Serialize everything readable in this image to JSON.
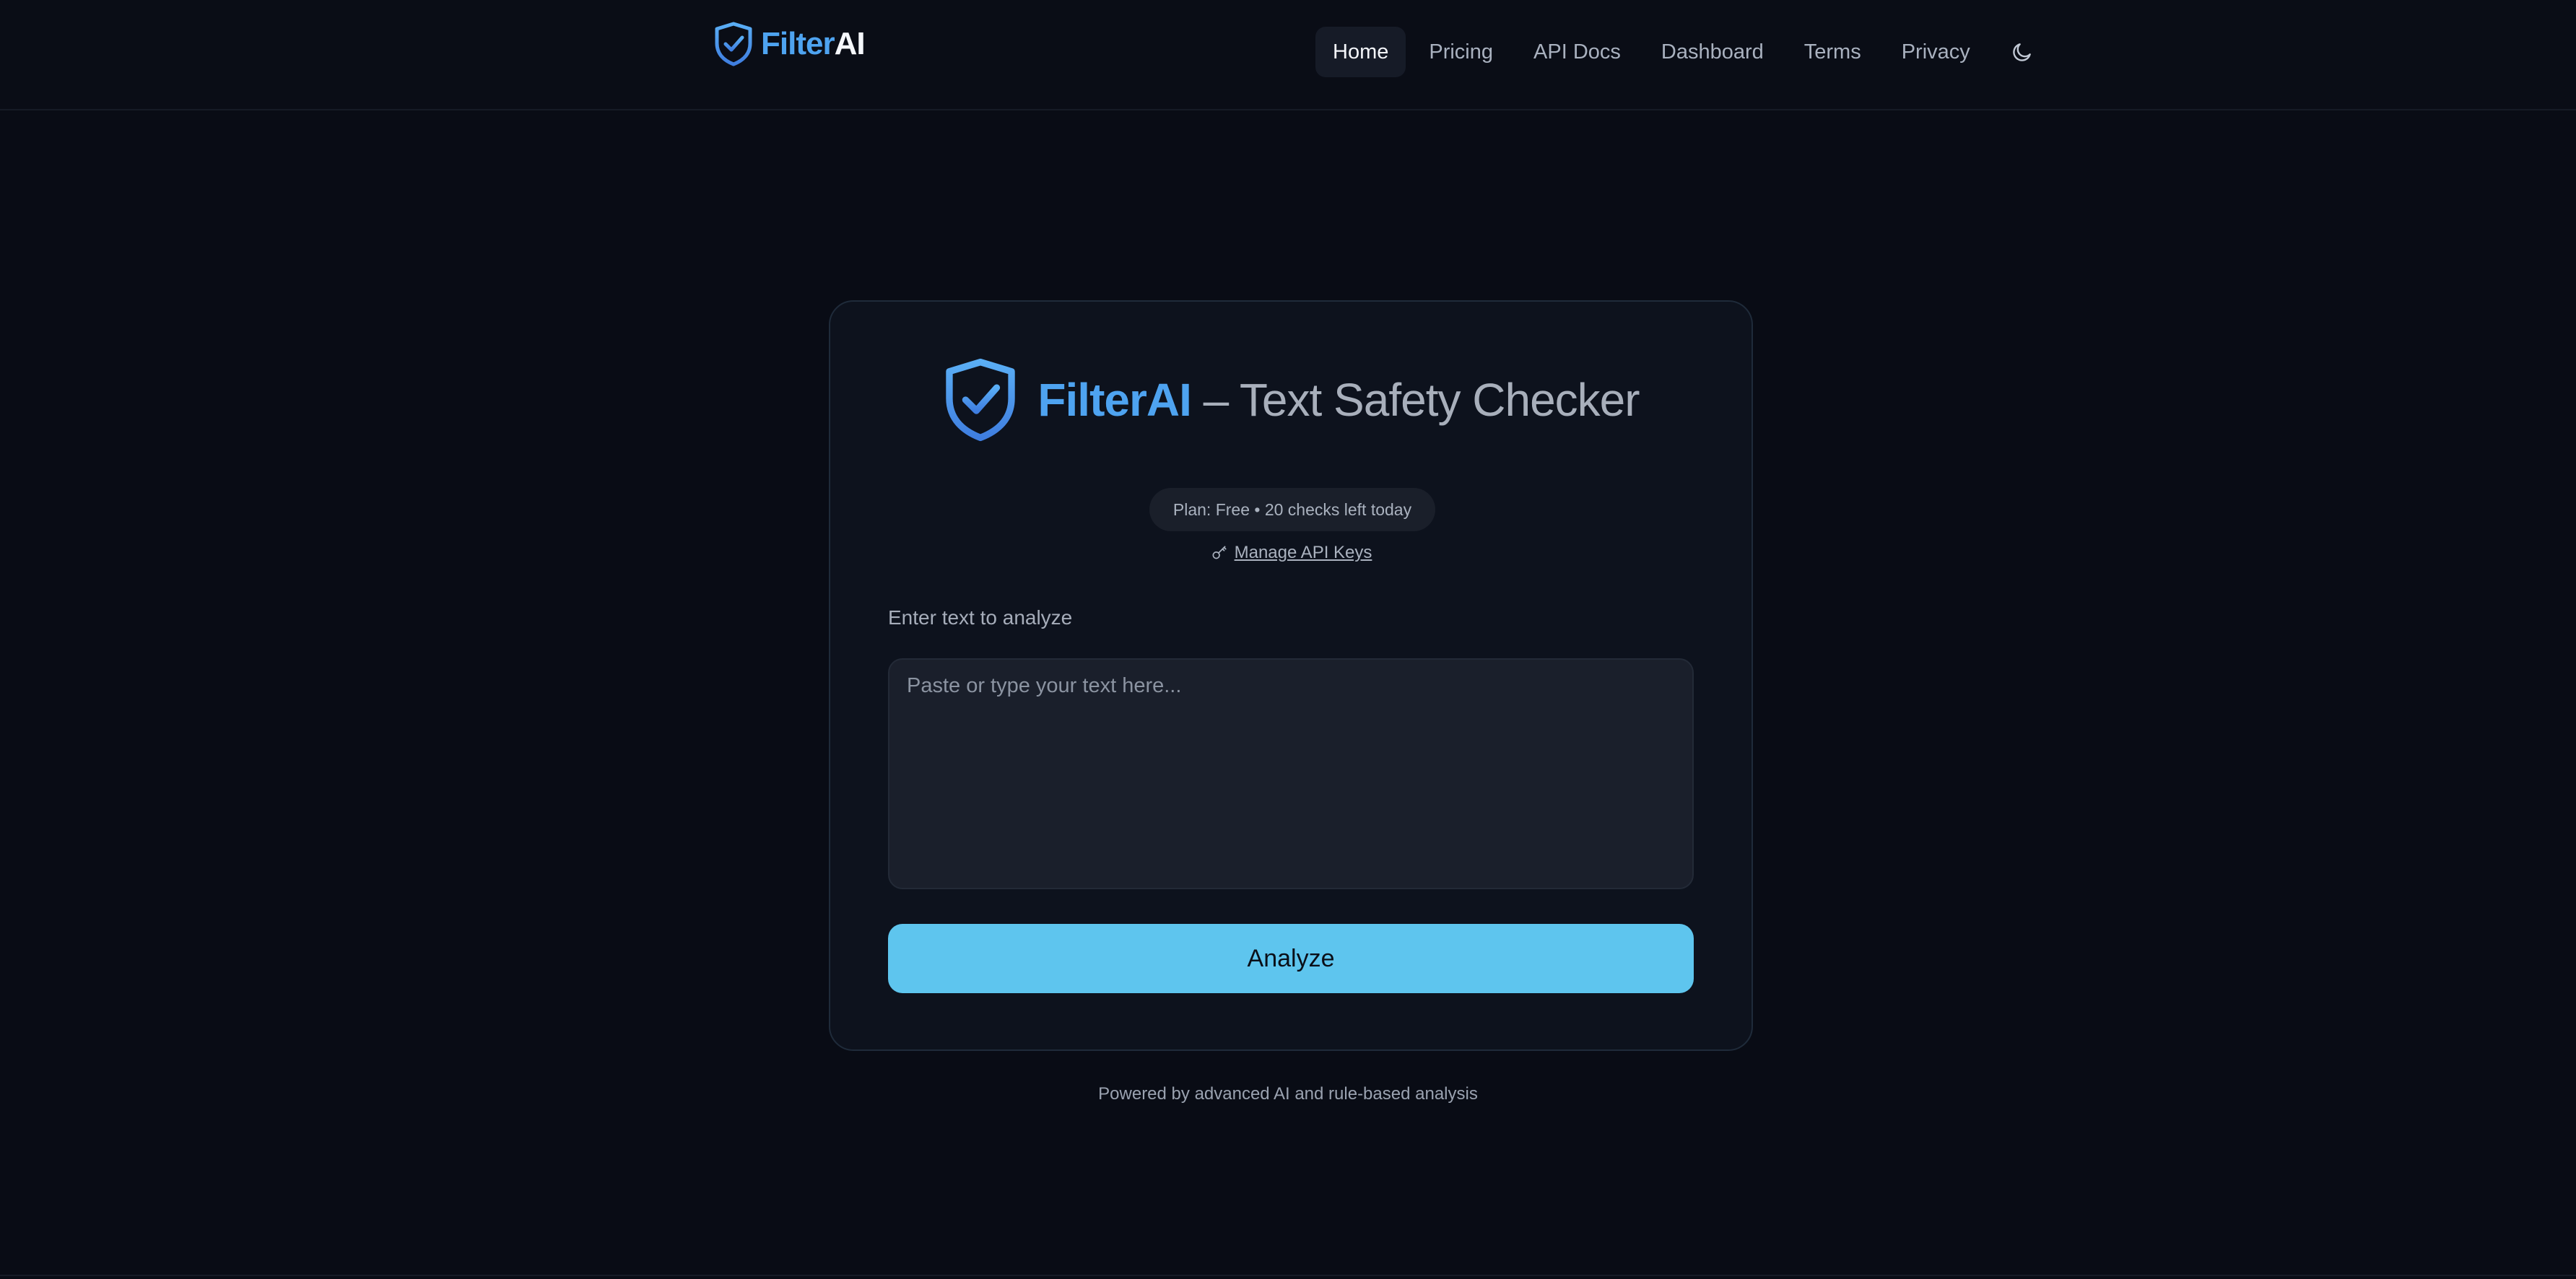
{
  "header": {
    "brand": {
      "part1": "Filter",
      "part2": "AI",
      "icon": "shield-check-icon"
    },
    "nav": [
      {
        "label": "Home",
        "active": true
      },
      {
        "label": "Pricing",
        "active": false
      },
      {
        "label": "API Docs",
        "active": false
      },
      {
        "label": "Dashboard",
        "active": false
      },
      {
        "label": "Terms",
        "active": false
      },
      {
        "label": "Privacy",
        "active": false
      }
    ],
    "theme_toggle_icon": "moon-icon"
  },
  "card": {
    "title_brand": "FilterAI",
    "title_rest": " – Text Safety Checker",
    "plan_badge": "Plan: Free • 20 checks left today",
    "api_keys_icon": "key-icon",
    "api_keys_link": "Manage API Keys",
    "field_label": "Enter text to analyze",
    "textarea_placeholder": "Paste or type your text here...",
    "textarea_value": "",
    "analyze_button": "Analyze"
  },
  "footer": {
    "note": "Powered by advanced AI and rule-based analysis"
  },
  "colors": {
    "background": "#090c15",
    "brand_blue": "#4ea3f0",
    "button": "#5ec5ee",
    "card": "#0d121d"
  }
}
